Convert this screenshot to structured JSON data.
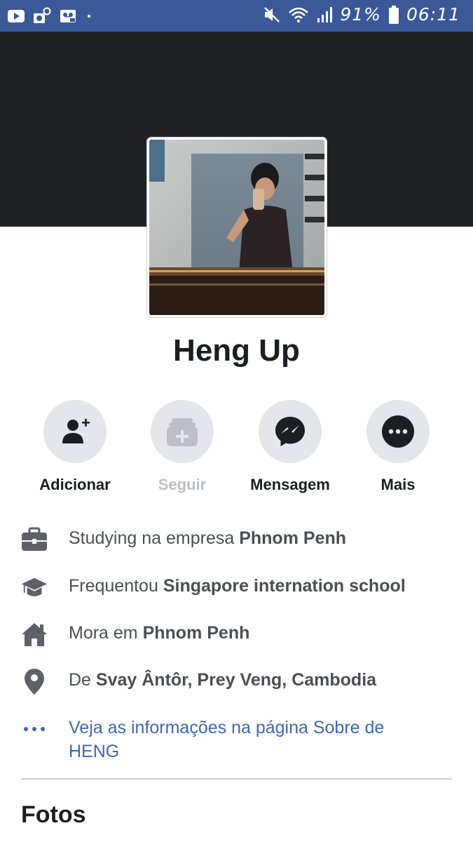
{
  "status_bar": {
    "battery": "91%",
    "time": "06:11",
    "icons": [
      "youtube-icon",
      "camera-icon",
      "voicemail-icon",
      "mute-icon",
      "wifi-icon",
      "signal-icon",
      "battery-icon"
    ],
    "color": "#3b5998"
  },
  "profile": {
    "name": "Heng Up",
    "cover_color": "#1f2125"
  },
  "actions": [
    {
      "label": "Adicionar",
      "icon": "add-friend-icon",
      "enabled": true
    },
    {
      "label": "Seguir",
      "icon": "follow-icon",
      "enabled": false
    },
    {
      "label": "Mensagem",
      "icon": "messenger-icon",
      "enabled": true
    },
    {
      "label": "Mais",
      "icon": "more-icon",
      "enabled": true
    }
  ],
  "info": {
    "work": {
      "prefix": "Studying na empresa ",
      "value": "Phnom Penh"
    },
    "education": {
      "prefix": "Frequentou ",
      "value": "Singapore internation school"
    },
    "lives": {
      "prefix": "Mora em ",
      "value": "Phnom Penh"
    },
    "from": {
      "prefix": "De ",
      "value": "Svay Ântôr, Prey Veng, Cambodia"
    },
    "about_link": "Veja as informações na página Sobre de HENG"
  },
  "sections": {
    "photos_title": "Fotos"
  },
  "colors": {
    "link": "#4267b2",
    "text": "#4b4f56"
  }
}
